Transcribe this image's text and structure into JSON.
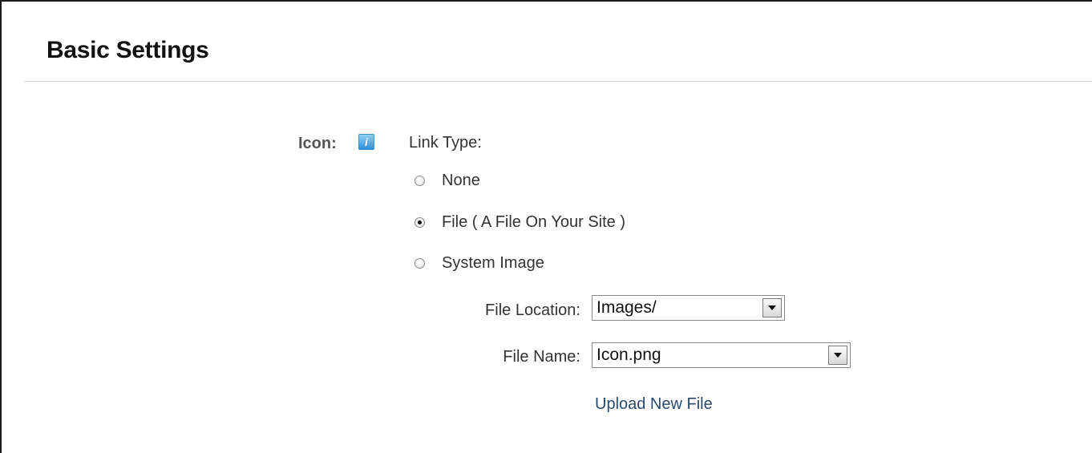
{
  "section": {
    "title": "Basic Settings"
  },
  "icon_field": {
    "label": "Icon:",
    "help_icon_glyph": "i",
    "link_type_label": "Link Type:",
    "options": [
      {
        "label": "None",
        "checked": false
      },
      {
        "label": "File ( A File On Your Site )",
        "checked": true
      },
      {
        "label": "System Image",
        "checked": false
      }
    ],
    "file_location": {
      "label": "File Location:",
      "value": "Images/"
    },
    "file_name": {
      "label": "File Name:",
      "value": "Icon.png"
    },
    "upload_link": "Upload New File"
  },
  "colors": {
    "help_icon": "#2f8fd6",
    "link": "#2b4a6e"
  }
}
